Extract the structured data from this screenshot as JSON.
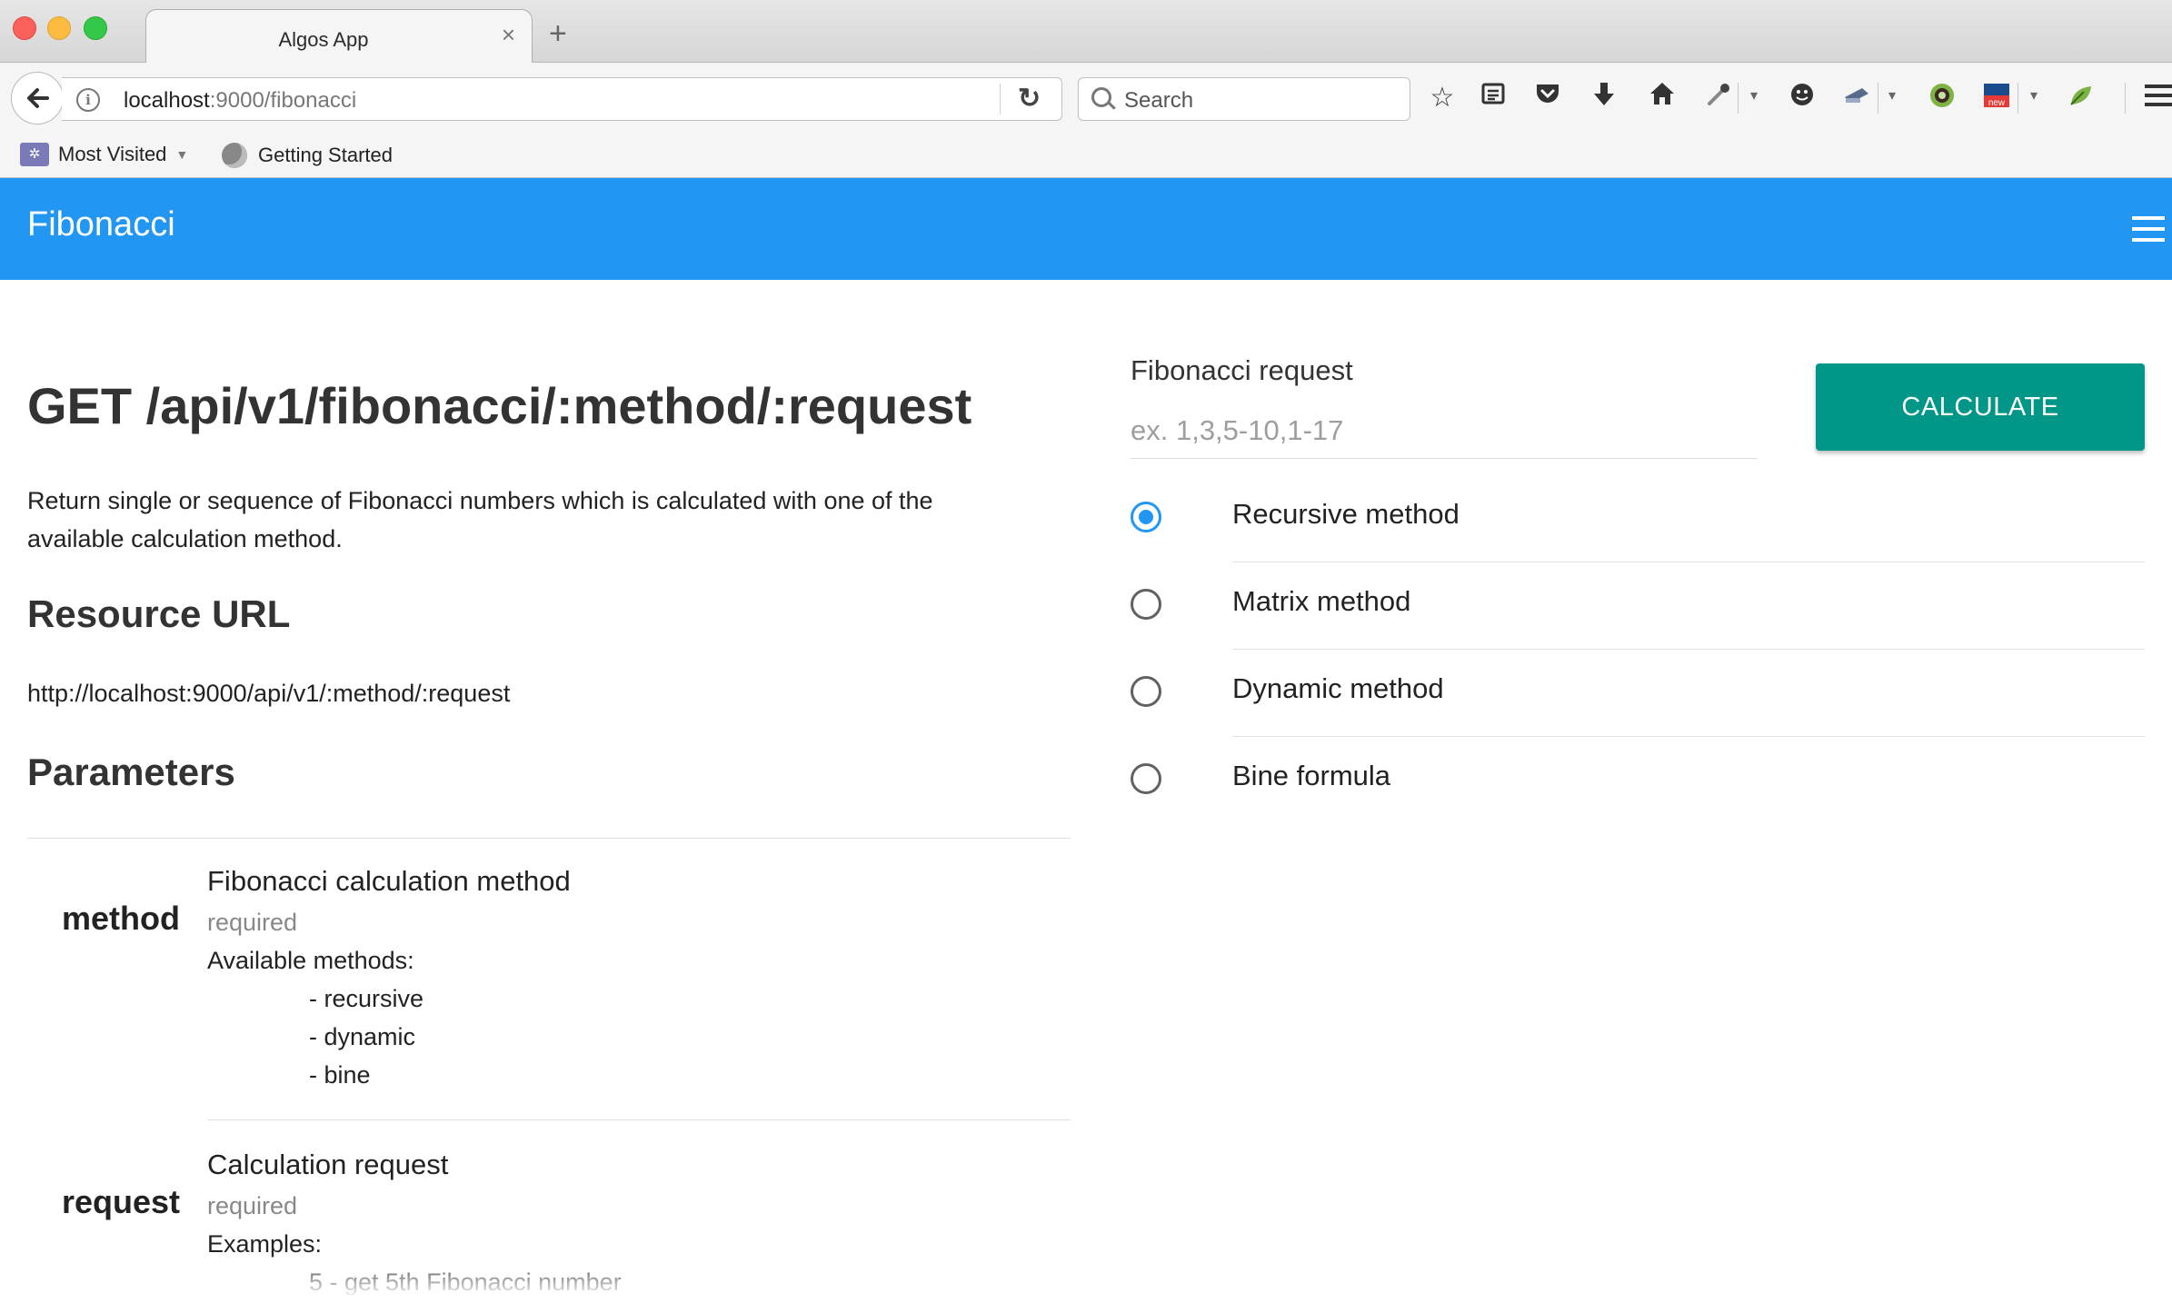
{
  "browser": {
    "tab_title": "Algos App",
    "tab_close": "×",
    "new_tab": "+",
    "url_host": "localhost",
    "url_path": ":9000/fibonacci",
    "search_placeholder": "Search",
    "toolbar_icons": [
      "back-arrow-icon",
      "info-icon",
      "reload-icon",
      "search-icon",
      "bookmark-star-icon",
      "reading-list-icon",
      "pocket-icon",
      "download-icon",
      "home-icon",
      "eyedropper-icon",
      "emoji-icon",
      "screenshot-icon",
      "extension-icon",
      "news-icon",
      "leaf-icon",
      "hamburger-menu-icon"
    ],
    "bookmarks": [
      {
        "label": "Most Visited"
      },
      {
        "label": "Getting Started"
      }
    ]
  },
  "app": {
    "title": "Fibonacci",
    "accent_color": "#2196f3",
    "button_color": "#009688"
  },
  "doc": {
    "endpoint": "GET /api/v1/fibonacci/:method/:request",
    "description": "Return single or sequence of Fibonacci numbers which is calculated with one of the available calculation method.",
    "resource_heading": "Resource URL",
    "resource_url": "http://localhost:9000/api/v1/:method/:request",
    "params_heading": "Parameters",
    "params": [
      {
        "name": "method",
        "title": "Fibonacci calculation method",
        "required": "required",
        "sub_label": "Available methods:",
        "items": [
          "- recursive",
          "- dynamic",
          "- bine"
        ]
      },
      {
        "name": "request",
        "title": "Calculation request",
        "required": "required",
        "sub_label": "Examples:",
        "items": [
          "5 - get 5th Fibonacci number"
        ]
      }
    ]
  },
  "form": {
    "label": "Fibonacci request",
    "placeholder": "ex. 1,3,5-10,1-17",
    "value": "",
    "calculate_label": "CALCULATE",
    "methods": [
      {
        "label": "Recursive method",
        "checked": true
      },
      {
        "label": "Matrix method",
        "checked": false
      },
      {
        "label": "Dynamic method",
        "checked": false
      },
      {
        "label": "Bine formula",
        "checked": false
      }
    ]
  }
}
